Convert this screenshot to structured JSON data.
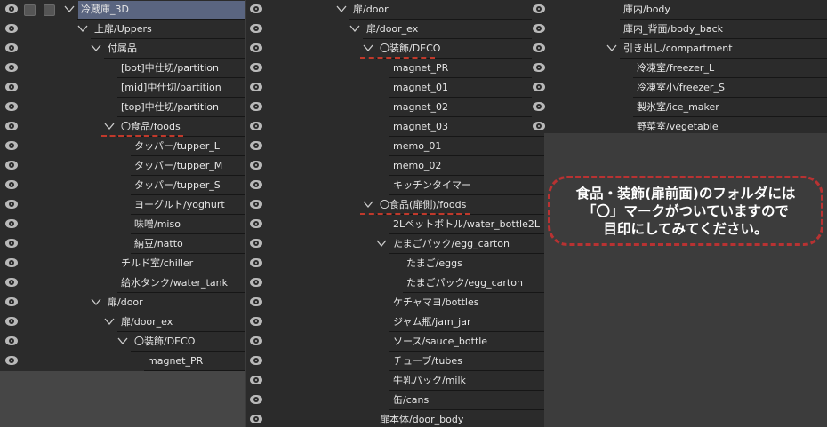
{
  "panel1": [
    {
      "label": "冷蔵庫_3D",
      "level": 0,
      "folder": true,
      "selected": true
    },
    {
      "label": "上扉/Uppers",
      "level": 1,
      "folder": true
    },
    {
      "label": "付属品",
      "level": 2,
      "folder": true
    },
    {
      "label": "[bot]中仕切/partition",
      "level": 3
    },
    {
      "label": "[mid]中仕切/partition",
      "level": 3
    },
    {
      "label": "[top]中仕切/partition",
      "level": 3
    },
    {
      "label": "〇食品/foods",
      "level": 3,
      "folder": true,
      "marked": true
    },
    {
      "label": "タッパー/tupper_L",
      "level": 4
    },
    {
      "label": "タッパー/tupper_M",
      "level": 4
    },
    {
      "label": "タッパー/tupper_S",
      "level": 4
    },
    {
      "label": "ヨーグルト/yoghurt",
      "level": 4
    },
    {
      "label": "味噌/miso",
      "level": 4
    },
    {
      "label": "納豆/natto",
      "level": 4
    },
    {
      "label": "チルド室/chiller",
      "level": 3
    },
    {
      "label": "給水タンク/water_tank",
      "level": 3
    },
    {
      "label": "扉/door",
      "level": 2,
      "folder": true
    },
    {
      "label": "扉/door_ex",
      "level": 3,
      "folder": true
    },
    {
      "label": "〇装飾/DECO",
      "level": 4,
      "folder": true
    },
    {
      "label": "magnet_PR",
      "level": 5
    }
  ],
  "panel2": [
    {
      "label": "扉/door",
      "level": 2,
      "folder": true
    },
    {
      "label": "扉/door_ex",
      "level": 3,
      "folder": true
    },
    {
      "label": "〇装飾/DECO",
      "level": 4,
      "folder": true,
      "marked": true
    },
    {
      "label": "magnet_PR",
      "level": 5
    },
    {
      "label": "magnet_01",
      "level": 5
    },
    {
      "label": "magnet_02",
      "level": 5
    },
    {
      "label": "magnet_03",
      "level": 5
    },
    {
      "label": "memo_01",
      "level": 5
    },
    {
      "label": "memo_02",
      "level": 5
    },
    {
      "label": "キッチンタイマー",
      "level": 5
    },
    {
      "label": "〇食品(扉側)/foods",
      "level": 4,
      "folder": true,
      "marked": true
    },
    {
      "label": "2Lペットボトル/water_bottle2L",
      "level": 5
    },
    {
      "label": "たまごパック/egg_carton",
      "level": 5,
      "folder": true
    },
    {
      "label": "たまご/eggs",
      "level": 6
    },
    {
      "label": "たまごパック/egg_carton",
      "level": 6
    },
    {
      "label": "ケチャマヨ/bottles",
      "level": 5
    },
    {
      "label": "ジャム瓶/jam_jar",
      "level": 5
    },
    {
      "label": "ソース/sauce_bottle",
      "level": 5
    },
    {
      "label": "チューブ/tubes",
      "level": 5
    },
    {
      "label": "牛乳パック/milk",
      "level": 5
    },
    {
      "label": "缶/cans",
      "level": 5
    },
    {
      "label": "扉本体/door_body",
      "level": 4
    }
  ],
  "panel3": [
    {
      "label": "庫内/body",
      "level": 1
    },
    {
      "label": "庫内_背面/body_back",
      "level": 1
    },
    {
      "label": "引き出し/compartment",
      "level": 1,
      "folder": true
    },
    {
      "label": "冷凍室/freezer_L",
      "level": 2
    },
    {
      "label": "冷凍室小/freezer_S",
      "level": 2
    },
    {
      "label": "製氷室/ice_maker",
      "level": 2
    },
    {
      "label": "野菜室/vegetable",
      "level": 2
    }
  ],
  "callout": {
    "lines": [
      "食品・装飾(扉前面)のフォルダには",
      "「〇」マークがついていますので",
      "目印にしてみてください。"
    ]
  },
  "colors": {
    "accent": "#c0392b",
    "selected": "#5a6580"
  }
}
